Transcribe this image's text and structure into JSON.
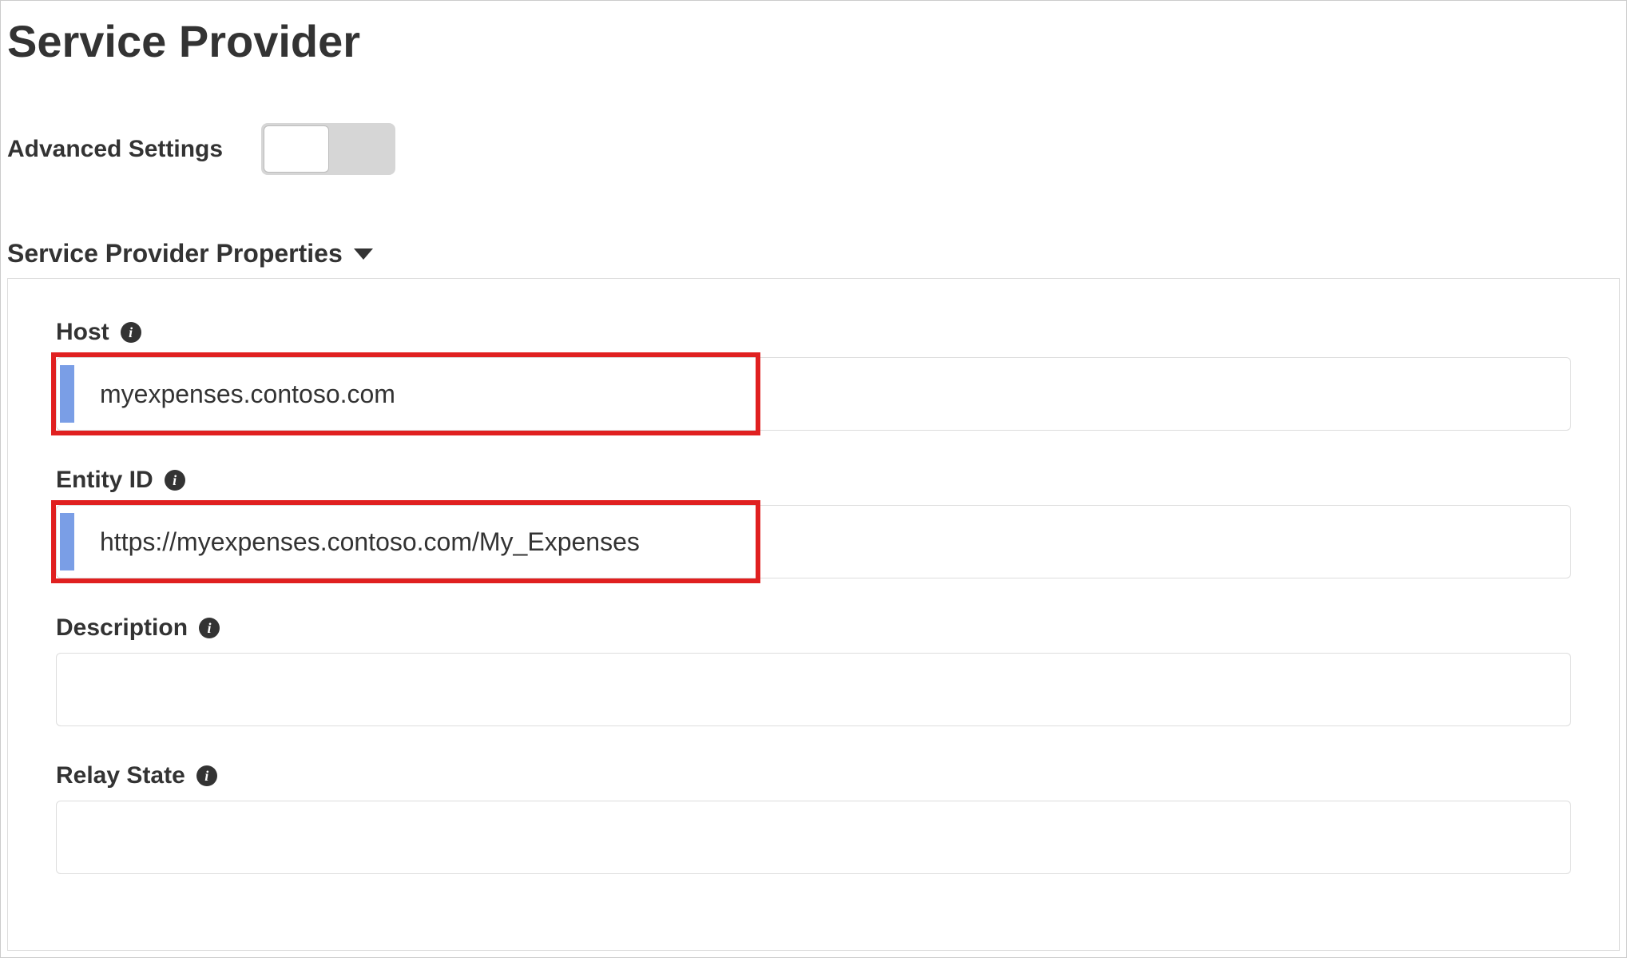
{
  "page_title": "Service Provider",
  "advanced_settings": {
    "label": "Advanced Settings",
    "enabled": false
  },
  "section": {
    "title": "Service Provider Properties",
    "expanded": true,
    "fields": {
      "host": {
        "label": "Host",
        "value": "myexpenses.contoso.com"
      },
      "entity_id": {
        "label": "Entity ID",
        "value": "https://myexpenses.contoso.com/My_Expenses"
      },
      "description": {
        "label": "Description",
        "value": ""
      },
      "relay_state": {
        "label": "Relay State",
        "value": ""
      }
    }
  }
}
